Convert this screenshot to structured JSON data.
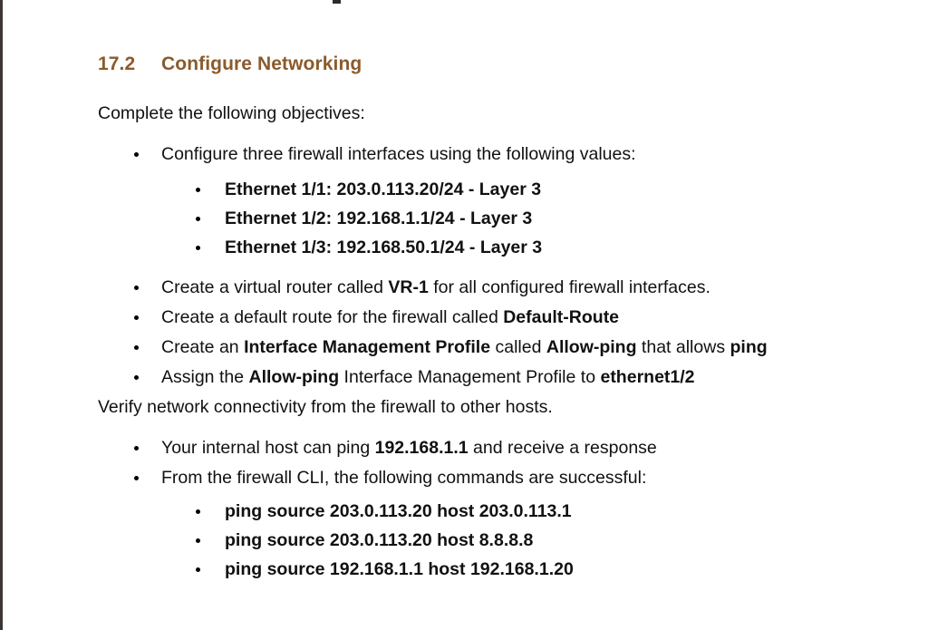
{
  "heading": {
    "number": "17.2",
    "title": "Configure Networking"
  },
  "intro_paragraph": "Complete the following objectives:",
  "verify_paragraph": "Verify network connectivity from the firewall to other hosts.",
  "interfaces_bullet": "Configure three firewall interfaces using the following values:",
  "interfaces": [
    "Ethernet 1/1: 203.0.113.20/24 - Layer 3",
    "Ethernet 1/2: 192.168.1.1/24 - Layer 3",
    "Ethernet 1/3: 192.168.50.1/24 - Layer 3"
  ],
  "tasks": [
    {
      "id": "virtual-router",
      "parts": [
        {
          "text": "Create a virtual router called ",
          "bold": false
        },
        {
          "text": "VR-1",
          "bold": true
        },
        {
          "text": " for all configured firewall interfaces.",
          "bold": false
        }
      ]
    },
    {
      "id": "default-route",
      "parts": [
        {
          "text": "Create a default route for the firewall called ",
          "bold": false
        },
        {
          "text": "Default-Route",
          "bold": true
        }
      ]
    },
    {
      "id": "mgmt-profile",
      "parts": [
        {
          "text": "Create an ",
          "bold": false
        },
        {
          "text": "Interface Management Profile",
          "bold": true
        },
        {
          "text": " called ",
          "bold": false
        },
        {
          "text": "Allow-ping",
          "bold": true
        },
        {
          "text": " that allows ",
          "bold": false
        },
        {
          "text": "ping",
          "bold": true
        }
      ]
    },
    {
      "id": "assign-profile",
      "parts": [
        {
          "text": "Assign the ",
          "bold": false
        },
        {
          "text": "Allow-ping",
          "bold": true
        },
        {
          "text": " Interface Management Profile to ",
          "bold": false
        },
        {
          "text": "ethernet1/2",
          "bold": true
        }
      ]
    }
  ],
  "checks": [
    {
      "id": "internal-host-ping",
      "parts": [
        {
          "text": "Your internal host can ping ",
          "bold": false
        },
        {
          "text": "192.168.1.1",
          "bold": true
        },
        {
          "text": " and receive a response",
          "bold": false
        }
      ]
    },
    {
      "id": "cli-commands",
      "parts": [
        {
          "text": "From the firewall CLI, the following commands are successful:",
          "bold": false
        }
      ]
    }
  ],
  "ping_commands": [
    "ping source 203.0.113.20 host 203.0.113.1",
    "ping source 203.0.113.20 host 8.8.8.8",
    "ping source 192.168.1.1 host 192.168.1.20"
  ],
  "colors": {
    "heading": "#8b5a2b",
    "body_text": "#111111",
    "page_background": "#ffffff",
    "left_border": "#3c3632"
  }
}
